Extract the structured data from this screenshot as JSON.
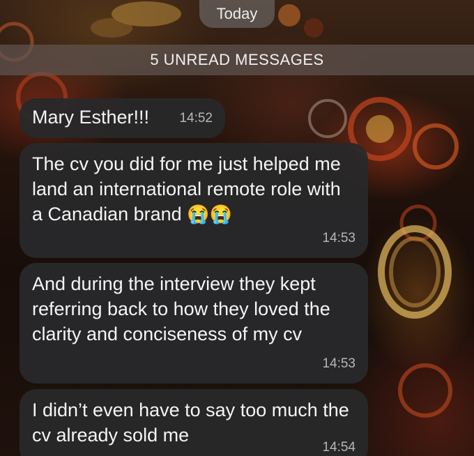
{
  "chat": {
    "date_label": "Today",
    "unread_banner": "5 UNREAD MESSAGES"
  },
  "messages": [
    {
      "text": "Mary Esther!!!",
      "time": "14:52"
    },
    {
      "text": "The cv you did for me just helped me land an international remote role with a Canadian brand",
      "emoji": "😭😭",
      "time": "14:53"
    },
    {
      "text": "And during the interview they kept referring back to how they loved the clarity and conciseness of my cv",
      "time": "14:53"
    },
    {
      "text": "I didn’t even have to say too much the cv already sold me",
      "time": "14:54"
    }
  ]
}
